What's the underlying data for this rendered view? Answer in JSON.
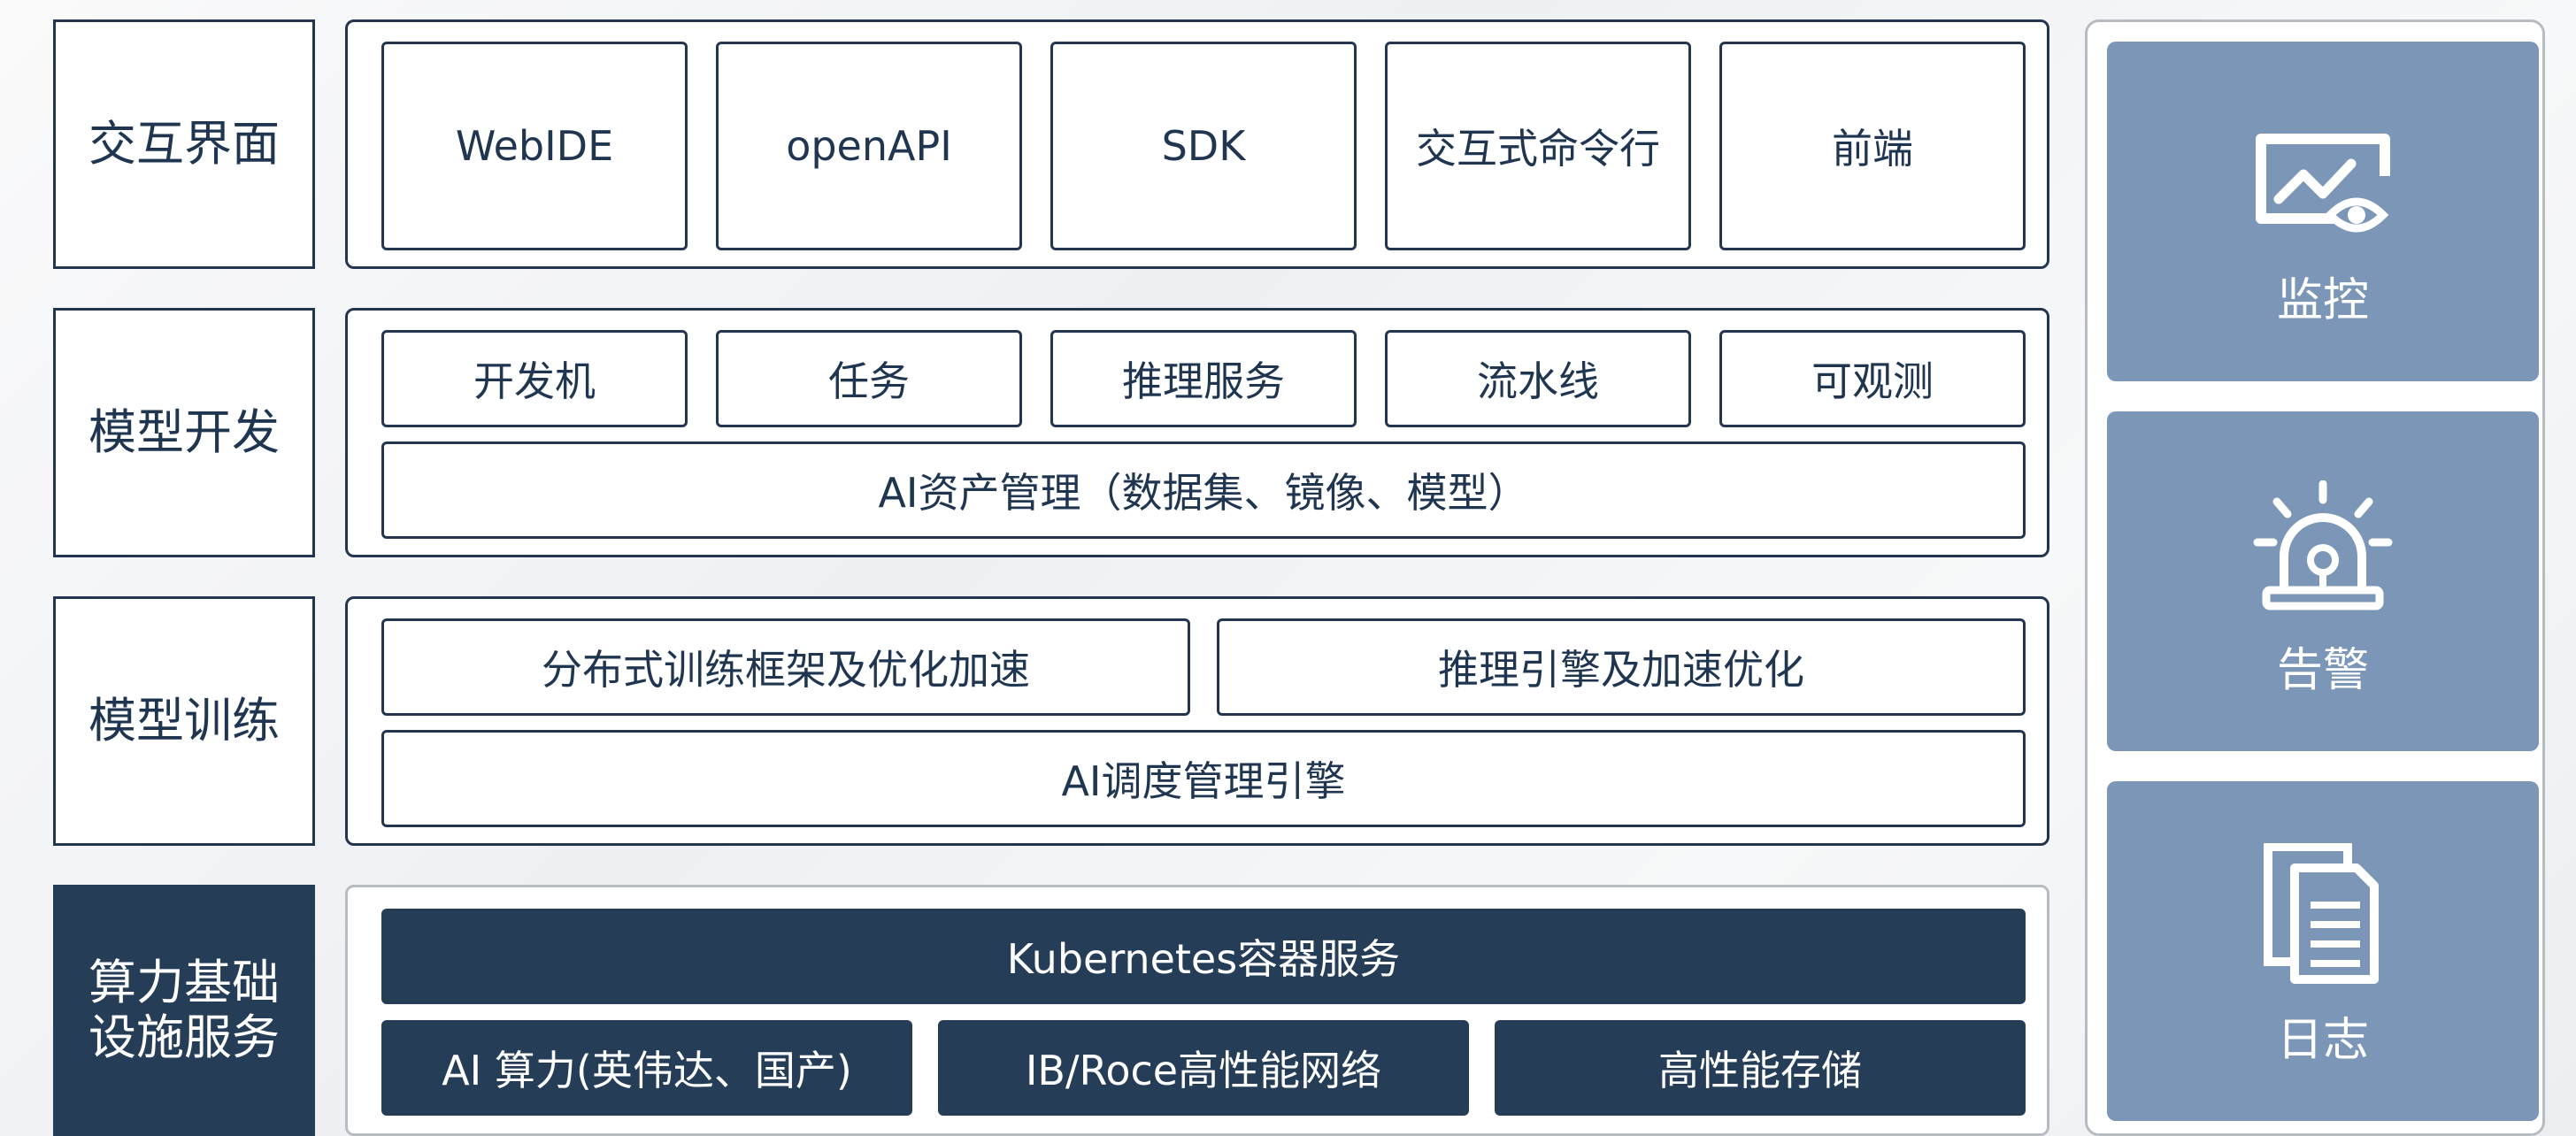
{
  "layers": [
    {
      "label": "交互界面",
      "items": [
        "WebIDE",
        "openAPI",
        "SDK",
        "交互式命令行",
        "前端"
      ]
    },
    {
      "label": "模型开发",
      "items": [
        "开发机",
        "任务",
        "推理服务",
        "流水线",
        "可观测"
      ],
      "bottom": "AI资产管理（数据集、镜像、模型）"
    },
    {
      "label": "模型训练",
      "items": [
        "分布式训练框架及优化加速",
        "推理引擎及加速优化"
      ],
      "bottom": "AI调度管理引擎"
    },
    {
      "label_line1": "算力基础",
      "label_line2": "设施服务",
      "top": "Kubernetes容器服务",
      "items": [
        "AI 算力(英伟达、国产)",
        "IB/Roce高性能网络",
        "高性能存储"
      ]
    }
  ],
  "side": {
    "cards": [
      {
        "label": "监控",
        "icon": "monitor-eye-icon"
      },
      {
        "label": "告警",
        "icon": "alarm-light-icon"
      },
      {
        "label": "日志",
        "icon": "document-log-icon"
      }
    ]
  },
  "colors": {
    "navy": "#263d58",
    "border": "#24364f",
    "side_card": "#7b96b6",
    "light_border": "#b7bcc3"
  }
}
